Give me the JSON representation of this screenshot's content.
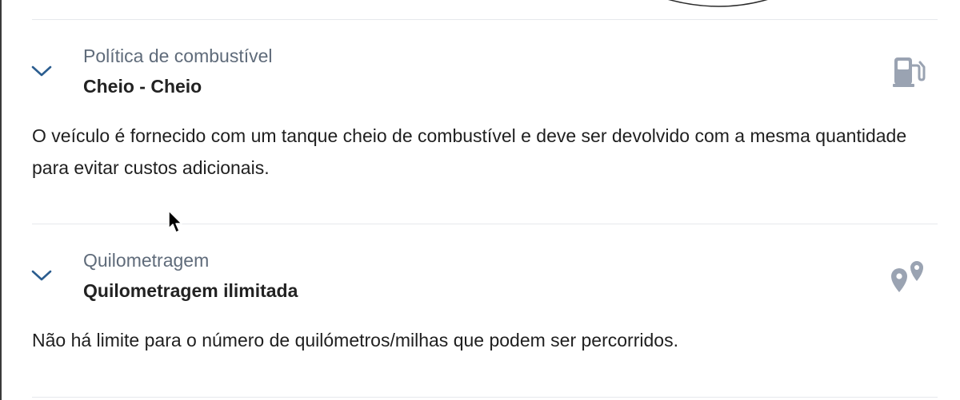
{
  "sections": [
    {
      "subtitle": "Política de combustível",
      "value": "Cheio - Cheio",
      "description": "O veículo é fornecido com um tanque cheio de combustível e deve ser devolvido com a mesma quantidade para evitar custos adicionais.",
      "icon": "fuel-pump-icon",
      "expanded": true
    },
    {
      "subtitle": "Quilometragem",
      "value": "Quilometragem ilimitada",
      "description": "Não há limite para o número de quilómetros/milhas que podem ser percorridos.",
      "icon": "map-pins-icon",
      "expanded": true
    }
  ],
  "colors": {
    "chevron": "#2b5d8f",
    "subtitle": "#5f6b7a",
    "value": "#222222",
    "icon": "#9aa3b2",
    "divider": "#e6e8ec"
  }
}
